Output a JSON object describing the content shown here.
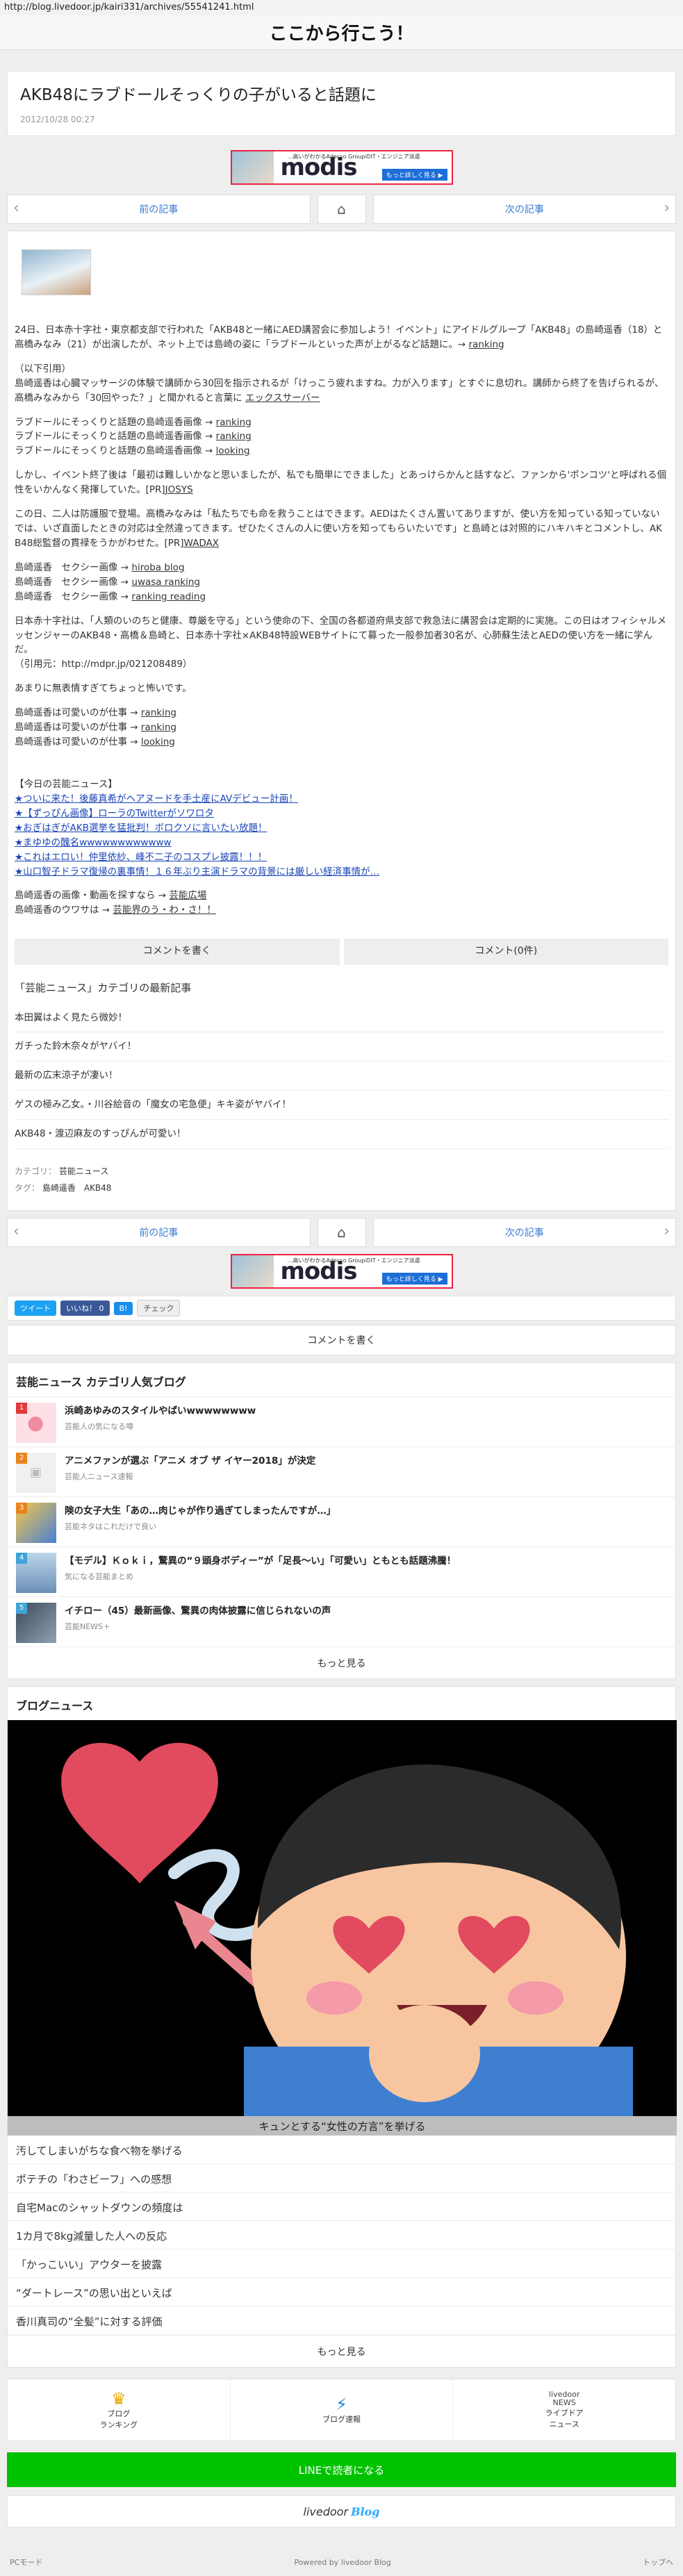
{
  "browser": {
    "url": "http://blog.livedoor.jp/kairi331/archives/55541241.html"
  },
  "site": {
    "name": "ここから行こう！"
  },
  "article": {
    "title": "AKB48にラブドールそっくりの子がいると話題に",
    "date": "2012/10/28 00:27"
  },
  "ad": {
    "tagline": "…高いがわかるAdecco GroupのIT・エンジニア派遣",
    "brand": "modis",
    "more": "もっと詳しく見る ▶"
  },
  "nav": {
    "prev": "前の記事",
    "next": "次の記事"
  },
  "body": {
    "p1": "24日、日本赤十字社・東京都支部で行われた「AKB48と一緒にAED講習会に参加しよう！イベント」にアイドルグループ「AKB48」の島崎遥香（18）と高橋みなみ（21）が出演したが、ネット上では島崎の姿に「ラブドールといった声が上がるなど話題に。→",
    "p1_link": "ranking",
    "p2": "（以下引用）\n島崎遥香は心臓マッサージの体験で講師から30回を指示されるが「けっこう疲れますね。力が入ります」とすぐに息切れ。講師から終了を告げられるが、高橋みなみから「30回やった？」と聞かれると言葉に",
    "p2_link": "エックスサーバー",
    "p3": [
      {
        "text": "ラブドールにそっくりと話題の島崎遥香画像 →",
        "link": "ranking"
      },
      {
        "text": "ラブドールにそっくりと話題の島崎遥香画像 →",
        "link": "ranking"
      },
      {
        "text": "ラブドールにそっくりと話題の島崎遥香画像 →",
        "link": "looking"
      }
    ],
    "p4": "しかし、イベント終了後は「最初は難しいかなと思いましたが、私でも簡単にできました」とあっけらかんと話すなど、ファンから'ポンコツ'と呼ばれる個性をいかんなく発揮していた。[PR]",
    "p4_link": "JOSYS",
    "p5": "この日、二人は防護服で登場。高橋みなみは「私たちでも命を救うことはできます。AEDはたくさん置いてありますが、使い方を知っている知っていないでは、いざ直面したときの対応は全然違ってきます。ぜひたくさんの人に使い方を知ってもらいたいです」と島崎とは対照的にハキハキとコメントし、AKB48総監督の貫禄をうかがわせた。[PR]",
    "p5_link": "WADAX",
    "p6": [
      {
        "text": "島崎遥香　セクシー画像 →",
        "link": "hiroba blog"
      },
      {
        "text": "島崎遥香　セクシー画像 →",
        "link": "uwasa ranking"
      },
      {
        "text": "島崎遥香　セクシー画像 →",
        "link": "ranking reading"
      }
    ],
    "p7": "日本赤十字社は、「人類のいのちと健康、尊厳を守る」という使命の下、全国の各都道府県支部で救急法に講習会は定期的に実施。この日はオフィシャルメッセンジャーのAKB48・高橋＆島崎と、日本赤十字社×AKB48特設WEBサイトにて募った一般参加者30名が、心肺蘇生法とAEDの使い方を一緒に学んだ。\n（引用元：http://mdpr.jp/021208489）",
    "p8": "あまりに無表情すぎてちょっと怖いです。",
    "p9": [
      {
        "text": "島崎遥香は可愛いのが仕事 →",
        "link": "ranking"
      },
      {
        "text": "島崎遥香は可愛いのが仕事 →",
        "link": "ranking"
      },
      {
        "text": "島崎遥香は可愛いのが仕事 →",
        "link": "looking"
      }
    ],
    "news_header": "【今日の芸能ニュース】",
    "news": [
      "★ついに来た！後藤真希がヘアヌードを手土産にAVデビュー計画！",
      "★【ずっぴん画像】ローラのTwitterがソワロタ",
      "★おぎはぎがAKB選挙を猛批判！ボロクソに言いたい放題！",
      "★まゆゆの醜名wwwwwwwwwwww",
      "★これはエロい！仲里依紗、峰不二子のコスプレ披露！！！",
      "★山口智子ドラマ復帰の裏事情！１６年ぶり主演ドラマの背景には厳しい経済事情が…"
    ],
    "p10": [
      {
        "text": "島崎遥香の画像・動画を探すなら →",
        "link": "芸能広場"
      },
      {
        "text": "島崎遥香のウワサは →",
        "link": "芸能界のう・わ・さ！！"
      }
    ],
    "comment_btn": "コメントを書く",
    "comment_count": "コメント(0件)"
  },
  "category": {
    "heading": "「芸能ニュース」カテゴリの最新記事",
    "items": [
      "本田翼はよく見たら微妙！",
      "ガチった鈴木奈々がヤバイ！",
      "最新の広末涼子が凄い！",
      "ゲスの極み乙女。・川谷絵音の「魔女の宅急便」キキ姿がヤバイ！",
      "AKB48・渡辺麻友のすっぴんが可愛い！"
    ],
    "meta_cat_label": "カテゴリ：",
    "meta_cat": "芸能ニュース",
    "meta_tag_label": "タグ：",
    "meta_tags": "島崎遥香　AKB48"
  },
  "social": {
    "tweet": "ツイート",
    "like": "いいね！ 0",
    "hatena": "B!",
    "check": "チェック"
  },
  "comment_write": "コメントを書く",
  "popular": {
    "title": "芸能ニュース カテゴリ人気ブログ",
    "items": [
      {
        "rank": "1",
        "title": "浜崎あゆみのスタイルやばいwwwwwwww",
        "sub": "芸能人の気になる噂"
      },
      {
        "rank": "2",
        "title": "アニメファンが選ぶ「アニメ オブ ザ イヤー2018」が決定",
        "sub": "芸能人ニュース速報"
      },
      {
        "rank": "3",
        "title": "険の女子大生「あの…肉じゃが作り過ぎてしまったんですが…」",
        "sub": "芸能ネタはこれだけで良い"
      },
      {
        "rank": "4",
        "title": "【モデル】Ｋｏｋｉ，驚異の“９頭身ボディー”が「足長〜い」「可愛い」ともとも話題沸騰！",
        "sub": "気になる芸能まとめ"
      },
      {
        "rank": "5",
        "title": "イチロー（45）最新画像、驚異の肉体披露に信じられないの声",
        "sub": "芸能NEWS＋"
      }
    ],
    "more": "もっと見る"
  },
  "blognews": {
    "title": "ブログニュース",
    "caption": "キュンとする“女性の方言”を挙げる",
    "items": [
      "汚してしまいがちな食べ物を挙げる",
      "ポテチの「わさビーフ」への感想",
      "自宅Macのシャットダウンの頻度は",
      "1カ月で8kg減量した人への反応",
      "「かっこいい」アウターを披露",
      "“ダートレース”の思い出といえば",
      "香川真司の“全髪”に対する評価"
    ],
    "more": "もっと見る"
  },
  "footer": {
    "icons": [
      {
        "icon": "♛",
        "label": "ブログ\nランキング"
      },
      {
        "icon": "⚡",
        "label": "ブログ速報"
      },
      {
        "icon": "livedoor\nNEWS",
        "label": "ライブドア\nニュース"
      }
    ],
    "line": "LINEで読者になる",
    "logo": "livedoor",
    "logo2": "Blog",
    "pc_mode": "PCモード",
    "powered": "Powered by livedoor Blog",
    "top": "トップへ"
  }
}
